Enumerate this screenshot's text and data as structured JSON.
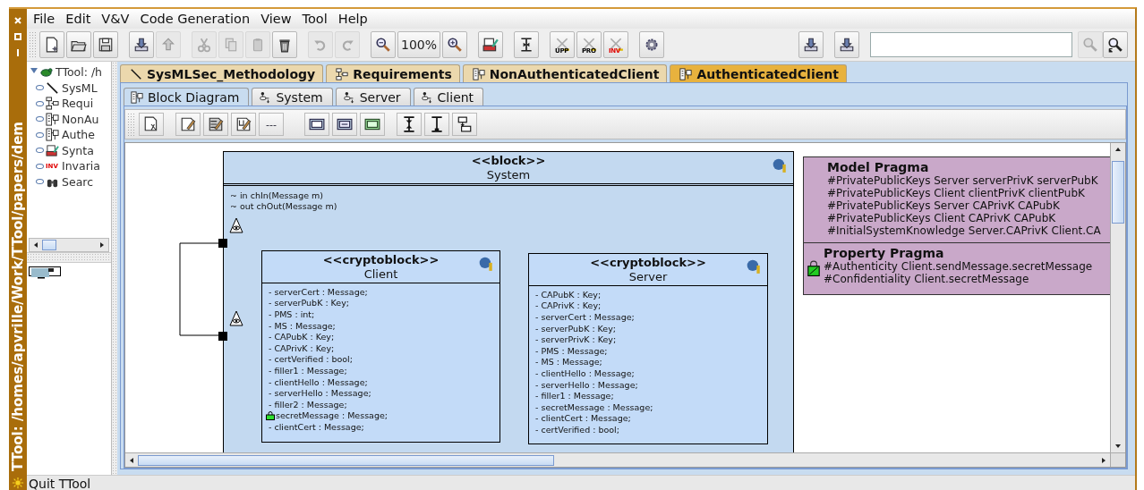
{
  "window": {
    "title": "TTool: /homes/apvrille/Work/TTool/papers/dem"
  },
  "menu": [
    "File",
    "Edit",
    "V&V",
    "Code Generation",
    "View",
    "Tool",
    "Help"
  ],
  "toolbar": {
    "groups": [
      [
        {
          "kind": "new",
          "disabled": false
        },
        {
          "kind": "open",
          "disabled": false
        },
        {
          "kind": "save",
          "disabled": false
        }
      ],
      [
        {
          "kind": "import",
          "disabled": false
        },
        {
          "kind": "export",
          "disabled": true
        }
      ],
      [
        {
          "kind": "cut",
          "disabled": true
        },
        {
          "kind": "copy",
          "disabled": true
        },
        {
          "kind": "paste",
          "disabled": true
        },
        {
          "kind": "delete",
          "disabled": false
        }
      ],
      [
        {
          "kind": "undo",
          "disabled": true
        },
        {
          "kind": "redo",
          "disabled": true
        }
      ],
      [
        {
          "kind": "zoom-out",
          "disabled": false
        },
        {
          "kind": "zoom-level",
          "label": "100%",
          "disabled": false
        },
        {
          "kind": "zoom-in",
          "disabled": false
        }
      ],
      [
        {
          "kind": "syntax",
          "disabled": false
        }
      ],
      [
        {
          "kind": "bracket",
          "disabled": false
        }
      ],
      [
        {
          "kind": "verify",
          "label": "UPP",
          "color": "#000000",
          "disabled": false
        },
        {
          "kind": "verify",
          "label": "PRO",
          "color": "#000000",
          "disabled": false
        },
        {
          "kind": "verify",
          "label": "INV",
          "color": "#e00000",
          "disabled": false
        }
      ],
      [
        {
          "kind": "gear",
          "disabled": false
        }
      ]
    ],
    "right_groups": [
      [
        {
          "kind": "import",
          "disabled": false
        }
      ],
      [
        {
          "kind": "import",
          "disabled": false
        }
      ]
    ],
    "search_buttons": [
      {
        "kind": "search",
        "disabled": true
      },
      {
        "kind": "search-engine",
        "disabled": false
      }
    ]
  },
  "tree": {
    "label": "TTool: /h",
    "expanded": true,
    "children": [
      {
        "label": "SysML",
        "kind": "methodology",
        "expanded": false
      },
      {
        "label": "Requi",
        "kind": "requirements",
        "expanded": false
      },
      {
        "label": "NonAu",
        "kind": "block-diagram",
        "expanded": false
      },
      {
        "label": "Authe",
        "kind": "block-diagram",
        "expanded": false
      },
      {
        "label": "Synta",
        "kind": "syntax",
        "expanded": false
      },
      {
        "label": "Invaria",
        "kind": "invariants",
        "icon_text": "INV",
        "expanded": false
      },
      {
        "label": "Searc",
        "kind": "search",
        "expanded": false
      }
    ]
  },
  "tabs": [
    {
      "label": "SysMLSec_Methodology",
      "kind": "methodology",
      "selected": false
    },
    {
      "label": "Requirements",
      "kind": "requirements",
      "selected": false
    },
    {
      "label": "NonAuthenticatedClient",
      "kind": "block-diagram",
      "selected": false
    },
    {
      "label": "AuthenticatedClient",
      "kind": "block-diagram",
      "selected": true
    }
  ],
  "subtabs": [
    {
      "label": "Block Diagram",
      "kind": "block-diagram",
      "selected": true
    },
    {
      "label": "System",
      "kind": "state-machine",
      "selected": false
    },
    {
      "label": "Server",
      "kind": "state-machine",
      "selected": false
    },
    {
      "label": "Client",
      "kind": "state-machine",
      "selected": false
    }
  ],
  "diagram_toolbar": [
    {
      "kind": "select"
    },
    {
      "kind": "comment"
    },
    {
      "kind": "constraint"
    },
    {
      "kind": "pragma"
    },
    {
      "kind": "text",
      "label": "---"
    },
    {
      "kind": "block"
    },
    {
      "kind": "cryptoblock"
    },
    {
      "kind": "datatype"
    },
    {
      "kind": "connector"
    },
    {
      "kind": "composition"
    },
    {
      "kind": "port-connector"
    }
  ],
  "diagram": {
    "system": {
      "stereotype": "<<block>>",
      "name": "System",
      "ports": [
        "~ in chIn(Message m)",
        "~ out chOut(Message m)"
      ]
    },
    "blocks": [
      {
        "stereotype": "<<cryptoblock>>",
        "name": "Client",
        "attributes": [
          {
            "text": "- serverCert : Message;",
            "secret": false
          },
          {
            "text": "- serverPubK : Key;",
            "secret": false
          },
          {
            "text": "- PMS : int;",
            "secret": false
          },
          {
            "text": "- MS : Message;",
            "secret": false
          },
          {
            "text": "- CAPubK : Key;",
            "secret": false
          },
          {
            "text": "- CAPrivK : Key;",
            "secret": false
          },
          {
            "text": "- certVerified : bool;",
            "secret": false
          },
          {
            "text": "- filler1 : Message;",
            "secret": false
          },
          {
            "text": "- clientHello : Message;",
            "secret": false
          },
          {
            "text": "- serverHello : Message;",
            "secret": false
          },
          {
            "text": "- filler2 : Message;",
            "secret": false
          },
          {
            "text": "secretMessage : Message;",
            "secret": true
          },
          {
            "text": "- clientCert : Message;",
            "secret": false
          }
        ]
      },
      {
        "stereotype": "<<cryptoblock>>",
        "name": "Server",
        "attributes": [
          {
            "text": "- CAPubK : Key;",
            "secret": false
          },
          {
            "text": "- CAPrivK : Key;",
            "secret": false
          },
          {
            "text": "- serverCert : Message;",
            "secret": false
          },
          {
            "text": "- serverPubK : Key;",
            "secret": false
          },
          {
            "text": "- serverPrivK : Key;",
            "secret": false
          },
          {
            "text": "- PMS : Message;",
            "secret": false
          },
          {
            "text": "- MS : Message;",
            "secret": false
          },
          {
            "text": "- clientHello : Message;",
            "secret": false
          },
          {
            "text": "- serverHello : Message;",
            "secret": false
          },
          {
            "text": "- filler1 : Message;",
            "secret": false
          },
          {
            "text": "- secretMessage : Message;",
            "secret": false
          },
          {
            "text": "- clientCert : Message;",
            "secret": false
          },
          {
            "text": "- certVerified : bool;",
            "secret": false
          }
        ]
      }
    ],
    "pragma": {
      "sections": [
        {
          "title": "Model Pragma",
          "kind": "model",
          "lines": [
            "#PrivatePublicKeys Server serverPrivK serverPubK",
            "#PrivatePublicKeys Client clientPrivK clientPubK",
            "#PrivatePublicKeys Server CAPrivK CAPubK",
            "#PrivatePublicKeys Client CAPrivK CAPubK",
            "#InitialSystemKnowledge Server.CAPrivK Client.CA"
          ]
        },
        {
          "title": "Property Pragma",
          "kind": "property",
          "lines": [
            "#Authenticity Client.sendMessage.secretMessage",
            "#Confidentiality Client.secretMessage"
          ]
        }
      ]
    }
  },
  "status_bar": {
    "text": "Quit TTool"
  }
}
